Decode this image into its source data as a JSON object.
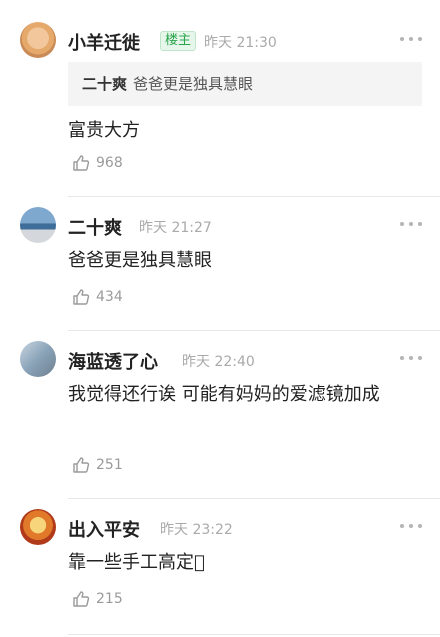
{
  "comments": [
    {
      "username": "小羊迁徙",
      "badge": "楼主",
      "time": "昨天 21:30",
      "quote_user": "二十爽",
      "quote_text": "爸爸更是独具慧眼",
      "text": "富贵大方",
      "likes": "968",
      "avatar": "cat-avatar"
    },
    {
      "username": "二十爽",
      "time": "昨天 21:27",
      "text": "爸爸更是独具慧眼",
      "likes": "434",
      "avatar": "landscape-avatar"
    },
    {
      "username": "海蓝透了心",
      "time": "昨天 22:40",
      "text": "我觉得还行诶 可能有妈妈的爱滤镜加成",
      "likes": "251",
      "avatar": "photo-avatar"
    },
    {
      "username": "出入平安",
      "time": "昨天 23:22",
      "text": "靠一些手工高定􁅊",
      "likes": "215",
      "avatar": "buddha-avatar"
    }
  ],
  "colors": {
    "badge_green": "#2aa54a",
    "muted_gray": "#9a9a9a"
  },
  "icons": [
    "more-icon",
    "thumbs-up-icon"
  ]
}
